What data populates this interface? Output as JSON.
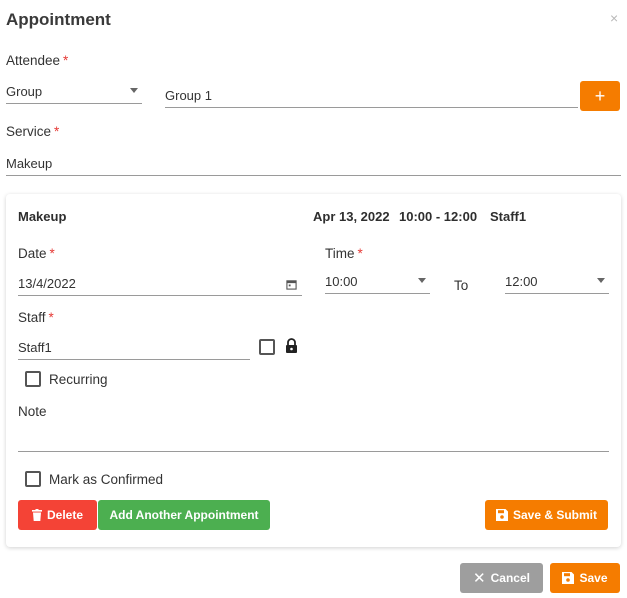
{
  "dialog": {
    "title": "Appointment",
    "close": "×"
  },
  "attendee": {
    "label": "Attendee",
    "required": "*",
    "type_value": "Group",
    "group_value": "Group 1",
    "add_label": "+"
  },
  "service": {
    "label": "Service",
    "required": "*",
    "value": "Makeup"
  },
  "appointment": {
    "service_name": "Makeup",
    "date_text": "Apr 13, 2022",
    "time_text": "10:00 - 12:00",
    "staff_text": "Staff1",
    "date_label": "Date",
    "date_value": "13/4/2022",
    "time_label": "Time",
    "time_from": "10:00",
    "to_label": "To",
    "time_to": "12:00",
    "staff_label": "Staff",
    "staff_value": "Staff1",
    "recurring_label": "Recurring",
    "note_label": "Note",
    "note_value": "",
    "confirmed_label": "Mark as Confirmed",
    "delete_label": "Delete",
    "add_another_label": "Add Another Appointment",
    "save_submit_label": "Save & Submit",
    "required": "*"
  },
  "footer": {
    "cancel_label": "Cancel",
    "save_label": "Save"
  },
  "colors": {
    "accent": "#f57c00",
    "danger": "#f44336",
    "success": "#4caf50",
    "neutral": "#9e9e9e"
  }
}
